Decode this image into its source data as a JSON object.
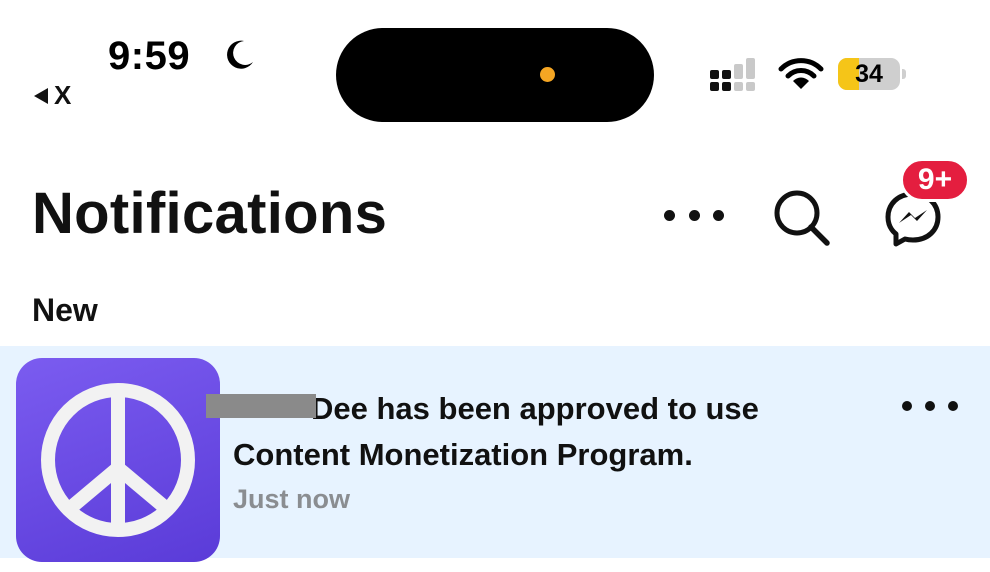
{
  "status_bar": {
    "time": "9:59",
    "back_label": "X",
    "battery_percent": "34",
    "battery_level": 0.34,
    "battery_color": "#f5c518",
    "island_dot_color": "#f5a623"
  },
  "header": {
    "title": "Notifications",
    "messenger_badge": "9+",
    "badge_color": "#e41e3f"
  },
  "section": {
    "label": "New"
  },
  "notifications": [
    {
      "line1": "Dee has been approved to use",
      "line2": "Content Monetization Program.",
      "time": "Just now",
      "highlight_color": "#e7f3ff",
      "avatar_icon": "peace-sign-icon"
    }
  ]
}
